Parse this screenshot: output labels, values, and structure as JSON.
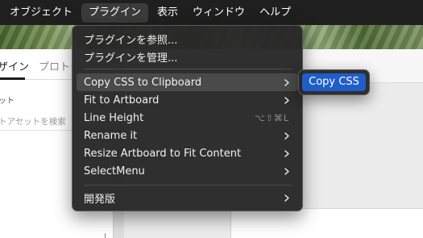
{
  "menubar": {
    "items": [
      {
        "label": "オブジェクト"
      },
      {
        "label": "プラグイン"
      },
      {
        "label": "表示"
      },
      {
        "label": "ウィンドウ"
      },
      {
        "label": "ヘルプ"
      }
    ]
  },
  "background_app": {
    "tabs": [
      "ザイン",
      "プロトタ"
    ],
    "section_label": "ット",
    "search_placeholder": "トアセットを検索"
  },
  "plugins_menu": {
    "items": [
      {
        "label": "プラグインを参照..."
      },
      {
        "label": "プラグインを管理..."
      },
      {
        "label": "Copy CSS to Clipboard",
        "submenu": true
      },
      {
        "label": "Fit to Artboard",
        "submenu": true
      },
      {
        "label": "Line Height",
        "shortcut": "⌥⇧⌘L"
      },
      {
        "label": "Rename it",
        "submenu": true
      },
      {
        "label": "Resize Artboard to Fit Content",
        "submenu": true
      },
      {
        "label": "SelectMenu",
        "submenu": true
      },
      {
        "label": "開発版",
        "submenu": true
      }
    ]
  },
  "submenu": {
    "items": [
      {
        "label": "Copy CSS"
      }
    ]
  },
  "colors": {
    "menubar_bg": "#1f1f1f",
    "menu_bg": "#282828",
    "submenu_highlight": "#1f5ec8"
  }
}
